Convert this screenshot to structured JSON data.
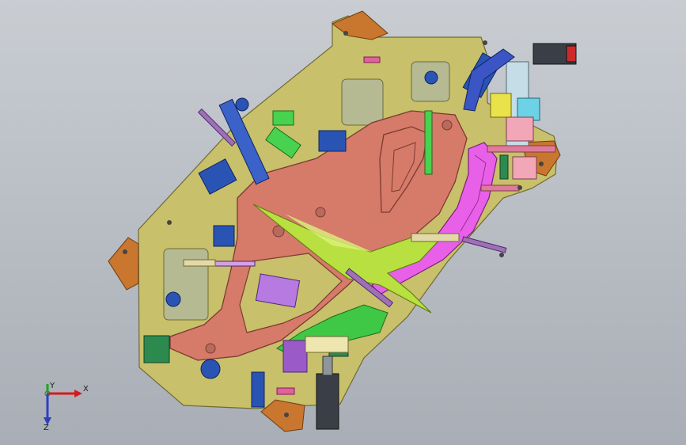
{
  "window": {
    "background_top": "#c9cdd2",
    "background_bottom": "#a9aeb6"
  },
  "triad": {
    "x_label": "X",
    "y_label": "Y",
    "z_label": "Z",
    "x_color": "#d21d1d",
    "y_color": "#1ea51e",
    "z_color": "#2d3fbf"
  },
  "model": {
    "base_plate_color": "#c8c06a",
    "frame_color": "#d67a6a",
    "channel_color": "#e860e8",
    "wedge_color": "#b8e040",
    "clamp_block_color": "#2a54b4",
    "corner_pad_color": "#c9762e"
  }
}
